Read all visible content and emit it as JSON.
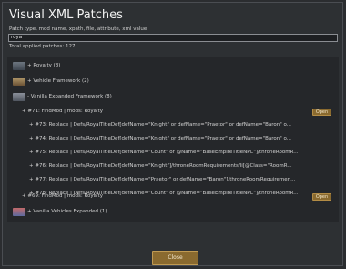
{
  "dialog": {
    "title": "Visual XML Patches",
    "search_hint": "Patch type, mod name, xpath, file, attribute, xml value",
    "search_value": "roya",
    "total_label": "Total applied patches: 127",
    "close_label": "Close"
  },
  "rows": [
    {
      "text": "+ Royalty (8)"
    },
    {
      "text": "+ Vehicle Framework (2)"
    },
    {
      "text": "- Vanilla Expanded Framework (8)"
    },
    {
      "text": "+ #71: FindMod | mods: Royalty",
      "button": "Open"
    },
    {
      "text": "+ #73: Replace | Defs/RoyalTitleDef[defName=\"Knight\" or defName=\"Praetor\" or defName=\"Baron\" o..."
    },
    {
      "text": "+ #74: Replace | Defs/RoyalTitleDef[defName=\"Knight\" or defName=\"Praetor\" or defName=\"Baron\" o..."
    },
    {
      "text": "+ #75: Replace | Defs/RoyalTitleDef[defName=\"Count\" or @Name=\"BaseEmpireTitleNPC\"]/throneRoomR..."
    },
    {
      "text": "+ #76: Replace | Defs/RoyalTitleDef[defName=\"Knight\"]/throneRoomRequirements/li[@Class=\"RoomR..."
    },
    {
      "text": "+ #77: Replace | Defs/RoyalTitleDef[defName=\"Praetor\" or defName=\"Baron\"]/throneRoomRequiremen..."
    },
    {
      "text": "+ #78: Replace | Defs/RoyalTitleDef[defName=\"Count\" or @Name=\"BaseEmpireTitleNPC\"]/throneRoomR..."
    },
    {
      "text": "+ #69: FindMod | mods: Royalty",
      "button": "Open"
    },
    {
      "text": "+ Vanilla Vehicles Expanded (1)"
    }
  ]
}
